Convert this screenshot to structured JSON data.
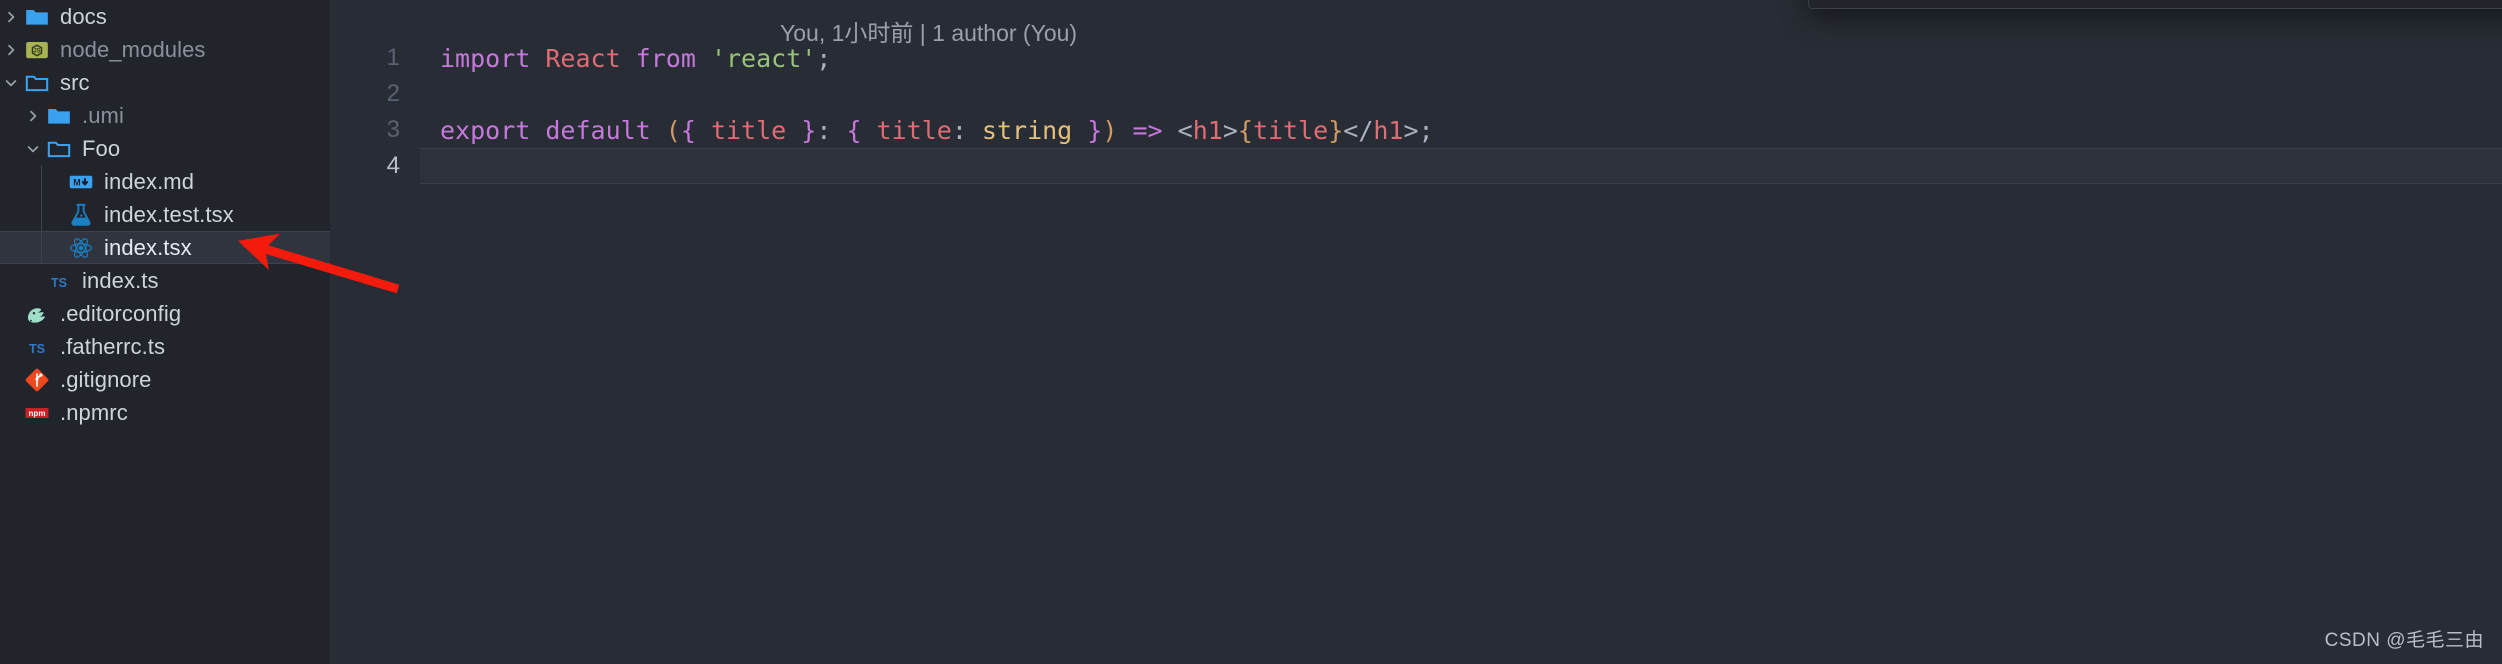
{
  "sidebar": {
    "rows": [
      {
        "label": "docs",
        "icon": "folder-icon",
        "twisty": "chevron-right",
        "indent": 0,
        "dim": false,
        "selected": false
      },
      {
        "label": "node_modules",
        "icon": "node-folder-icon",
        "twisty": "chevron-right",
        "indent": 0,
        "dim": true,
        "selected": false
      },
      {
        "label": "src",
        "icon": "folder-open-icon",
        "twisty": "chevron-down",
        "indent": 0,
        "dim": false,
        "selected": false
      },
      {
        "label": ".umi",
        "icon": "folder-icon",
        "twisty": "chevron-right",
        "indent": 1,
        "dim": true,
        "selected": false
      },
      {
        "label": "Foo",
        "icon": "folder-open-icon",
        "twisty": "chevron-down",
        "indent": 1,
        "dim": false,
        "selected": false
      },
      {
        "label": "index.md",
        "icon": "markdown-icon",
        "twisty": "none",
        "indent": 2,
        "dim": false,
        "selected": false
      },
      {
        "label": "index.test.tsx",
        "icon": "test-flask-icon",
        "twisty": "none",
        "indent": 2,
        "dim": false,
        "selected": false
      },
      {
        "label": "index.tsx",
        "icon": "react-icon",
        "twisty": "none",
        "indent": 2,
        "dim": false,
        "selected": true
      },
      {
        "label": "index.ts",
        "icon": "typescript-icon",
        "twisty": "none",
        "indent": 1,
        "dim": false,
        "selected": false
      },
      {
        "label": ".editorconfig",
        "icon": "editorconfig-icon",
        "twisty": "none",
        "indent": 0,
        "dim": false,
        "selected": false
      },
      {
        "label": ".fatherrc.ts",
        "icon": "typescript-icon",
        "twisty": "none",
        "indent": 0,
        "dim": false,
        "selected": false
      },
      {
        "label": ".gitignore",
        "icon": "git-icon",
        "twisty": "none",
        "indent": 0,
        "dim": false,
        "selected": false
      },
      {
        "label": ".npmrc",
        "icon": "npm-icon",
        "twisty": "none",
        "indent": 0,
        "dim": false,
        "selected": false
      }
    ]
  },
  "editor": {
    "blame": "You, 1小时前 | 1 author (You)",
    "lines": [
      {
        "number": "1",
        "active": false,
        "tokens": [
          {
            "text": "import ",
            "cls": "t-kw"
          },
          {
            "text": "React ",
            "cls": "t-cls"
          },
          {
            "text": "from ",
            "cls": "t-kw"
          },
          {
            "text": "'react'",
            "cls": "t-str"
          },
          {
            "text": ";",
            "cls": "t-punc"
          }
        ]
      },
      {
        "number": "2",
        "active": false,
        "tokens": []
      },
      {
        "number": "3",
        "active": false,
        "tokens": [
          {
            "text": "export default ",
            "cls": "t-kw"
          },
          {
            "text": "(",
            "cls": "t-brace"
          },
          {
            "text": "{ ",
            "cls": "t-kw"
          },
          {
            "text": "title",
            "cls": "t-cls"
          },
          {
            "text": " }",
            "cls": "t-kw"
          },
          {
            "text": ": ",
            "cls": "t-punc"
          },
          {
            "text": "{ ",
            "cls": "t-kw"
          },
          {
            "text": "title",
            "cls": "t-cls"
          },
          {
            "text": ": ",
            "cls": "t-punc"
          },
          {
            "text": "string",
            "cls": "t-type"
          },
          {
            "text": " }",
            "cls": "t-kw"
          },
          {
            "text": ")",
            "cls": "t-brace"
          },
          {
            "text": " ",
            "cls": "t-punc"
          },
          {
            "text": "=>",
            "cls": "t-arrow"
          },
          {
            "text": " ",
            "cls": "t-punc"
          },
          {
            "text": "<",
            "cls": "t-tagb"
          },
          {
            "text": "h1",
            "cls": "t-cls"
          },
          {
            "text": ">",
            "cls": "t-tagb"
          },
          {
            "text": "{",
            "cls": "t-brace"
          },
          {
            "text": "title",
            "cls": "t-cls"
          },
          {
            "text": "}",
            "cls": "t-brace"
          },
          {
            "text": "</",
            "cls": "t-tagb"
          },
          {
            "text": "h1",
            "cls": "t-cls"
          },
          {
            "text": ">",
            "cls": "t-tagb"
          },
          {
            "text": ";",
            "cls": "t-punc"
          }
        ]
      },
      {
        "number": "4",
        "active": true,
        "tokens": []
      }
    ]
  },
  "annotation": {
    "arrow_color": "#f51b0c"
  },
  "watermark": {
    "text": "CSDN @毛毛三由"
  }
}
